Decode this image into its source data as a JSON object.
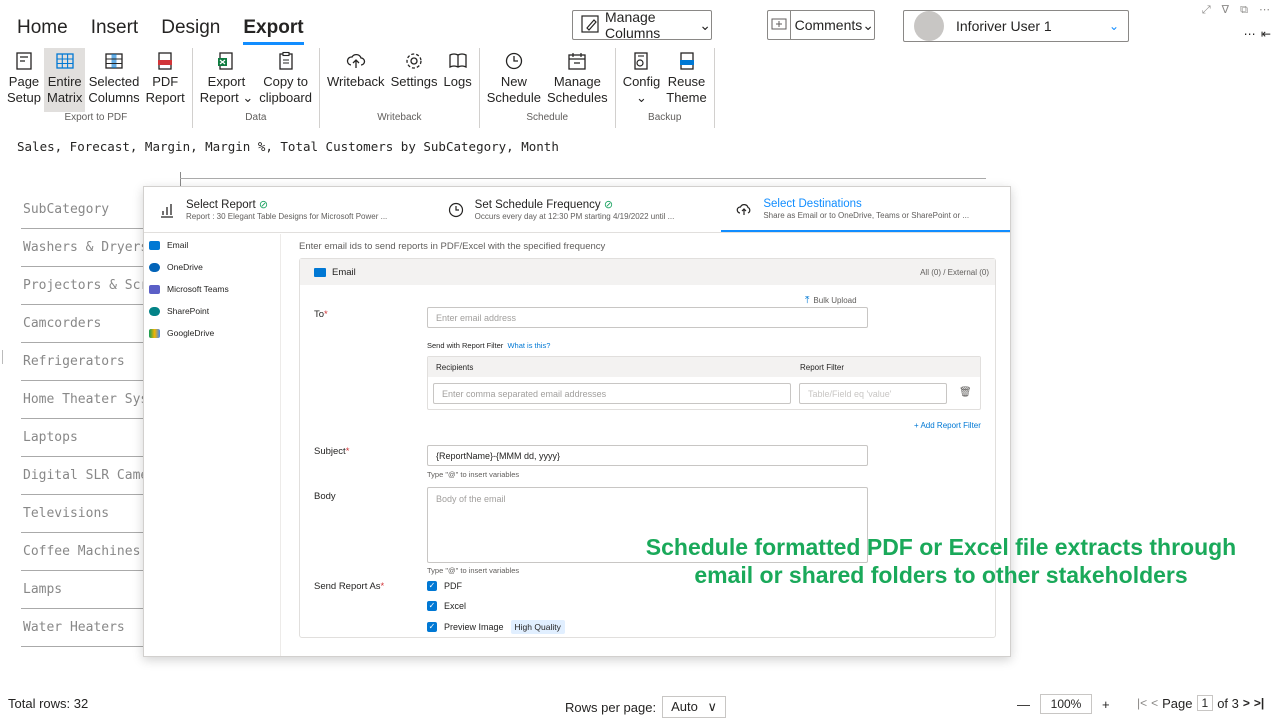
{
  "tabs": [
    {
      "label": "Home",
      "active": false
    },
    {
      "label": "Insert",
      "active": false
    },
    {
      "label": "Design",
      "active": false
    },
    {
      "label": "Export",
      "active": true
    }
  ],
  "toolbar": {
    "manage_columns": "Manage Columns",
    "comments": "Comments",
    "user": "Inforiver User 1"
  },
  "ribbon": {
    "groups": [
      {
        "label": "Export to PDF",
        "buttons": [
          {
            "line1": "Page",
            "line2": "Setup",
            "icon": "page-setup-icon"
          },
          {
            "line1": "Entire",
            "line2": "Matrix",
            "icon": "grid-icon",
            "selected": true
          },
          {
            "line1": "Selected",
            "line2": "Columns",
            "icon": "columns-icon"
          },
          {
            "line1": "PDF",
            "line2": "Report",
            "icon": "pdf-icon"
          }
        ]
      },
      {
        "label": "Data",
        "buttons": [
          {
            "line1": "Export",
            "line2": "Report ⌄",
            "icon": "excel-icon"
          },
          {
            "line1": "Copy to",
            "line2": "clipboard",
            "icon": "clipboard-icon"
          }
        ]
      },
      {
        "label": "Writeback",
        "buttons": [
          {
            "line1": "Writeback",
            "line2": "",
            "icon": "cloud-upload-icon"
          },
          {
            "line1": "Settings",
            "line2": "",
            "icon": "gear-icon"
          },
          {
            "line1": "Logs",
            "line2": "",
            "icon": "book-icon"
          }
        ]
      },
      {
        "label": "Schedule",
        "buttons": [
          {
            "line1": "New",
            "line2": "Schedule",
            "icon": "clock-icon"
          },
          {
            "line1": "Manage",
            "line2": "Schedules",
            "icon": "calendar-icon"
          }
        ]
      },
      {
        "label": "Backup",
        "buttons": [
          {
            "line1": "Config",
            "line2": "⌄",
            "icon": "config-icon"
          },
          {
            "line1": "Reuse",
            "line2": "Theme",
            "icon": "json-icon"
          }
        ]
      }
    ]
  },
  "subtitle": "Sales, Forecast, Margin, Margin %, Total Customers by SubCategory, Month",
  "table_rows": [
    "SubCategory",
    "Washers & Dryers",
    "Projectors & Scree",
    "Camcorders",
    "Refrigerators",
    "Home Theater Syste",
    "Laptops",
    "Digital SLR Camera",
    "Televisions",
    "Coffee Machines",
    "Lamps",
    "Water Heaters"
  ],
  "dialog": {
    "steps": [
      {
        "title": "Select Report",
        "sub": "Report : 30 Elegant Table Designs for Microsoft Power ...",
        "done": true
      },
      {
        "title": "Set Schedule Frequency",
        "sub": "Occurs every day at 12:30 PM starting 4/19/2022 until ...",
        "done": true
      },
      {
        "title": "Select Destinations",
        "sub": "Share as Email or to OneDrive, Teams or SharePoint or ...",
        "done": false
      }
    ],
    "destinations": [
      {
        "label": "Email",
        "color": "#0078d4"
      },
      {
        "label": "OneDrive",
        "color": "#0364b8"
      },
      {
        "label": "Microsoft Teams",
        "color": "#5b5fc7"
      },
      {
        "label": "SharePoint",
        "color": "#038387"
      },
      {
        "label": "GoogleDrive",
        "color": "#f4b400"
      }
    ],
    "intro": "Enter email ids to send reports in PDF/Excel with the specified frequency",
    "panel_title": "Email",
    "panel_count": "All (0) / External (0)",
    "bulk_upload": "Bulk Upload",
    "to_label": "To",
    "to_placeholder": "Enter email address",
    "filter_hint": "Send with Report Filter",
    "filter_link": "What is this?",
    "col_recipients": "Recipients",
    "col_filter": "Report Filter",
    "recipients_placeholder": "Enter comma separated email addresses",
    "filter_placeholder": "Table/Field eq 'value'",
    "add_filter": "+ Add Report Filter",
    "subject_label": "Subject",
    "subject_value": "{ReportName}-{MMM dd, yyyy}",
    "var_hint": "Type \"@\" to insert variables",
    "body_label": "Body",
    "body_placeholder": "Body of the email",
    "send_as_label": "Send Report As",
    "options": [
      "PDF",
      "Excel",
      "Preview Image"
    ],
    "quality": "High Quality"
  },
  "overlay_text": "Schedule formatted PDF or Excel file extracts through email or shared folders to other stakeholders",
  "footer": {
    "total": "Total rows: 32",
    "rows_per_page_label": "Rows per page:",
    "rows_per_page_value": "Auto",
    "zoom": "100%",
    "page_label": "Page",
    "page_value": "1",
    "page_of": "of 3"
  }
}
